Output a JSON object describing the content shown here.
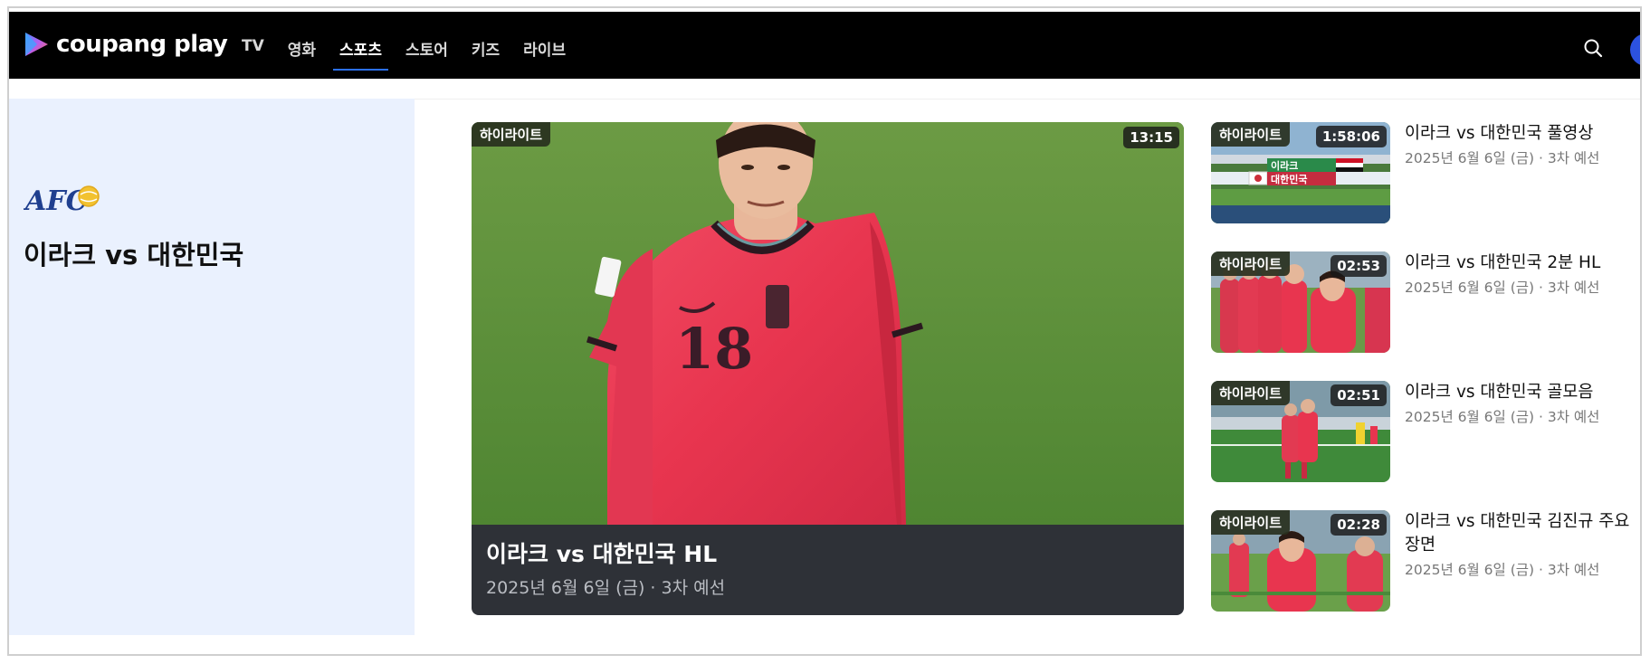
{
  "header": {
    "logo_text": "coupang play",
    "nav": [
      {
        "label": "TV",
        "active": false
      },
      {
        "label": "영화",
        "active": false
      },
      {
        "label": "스포츠",
        "active": true
      },
      {
        "label": "스토어",
        "active": false
      },
      {
        "label": "키즈",
        "active": false
      },
      {
        "label": "라이브",
        "active": false
      }
    ]
  },
  "league": {
    "logo_text": "AFC",
    "title": "이라크 vs 대한민국"
  },
  "feature": {
    "badge": "하이라이트",
    "duration": "13:15",
    "title": "이라크 vs 대한민국 HL",
    "meta": "2025년 6월 6일 (금) · 3차 예선",
    "jersey_number": "18"
  },
  "side_items": [
    {
      "badge": "하이라이트",
      "duration": "1:58:06",
      "title": "이라크 vs 대한민국 풀영상",
      "meta": "2025년 6월 6일 (금) · 3차 예선",
      "scoreboard_top": "이라크",
      "scoreboard_bottom": "대한민국"
    },
    {
      "badge": "하이라이트",
      "duration": "02:53",
      "title": "이라크 vs 대한민국 2분 HL",
      "meta": "2025년 6월 6일 (금) · 3차 예선"
    },
    {
      "badge": "하이라이트",
      "duration": "02:51",
      "title": "이라크 vs 대한민국 골모음",
      "meta": "2025년 6월 6일 (금) · 3차 예선"
    },
    {
      "badge": "하이라이트",
      "duration": "02:28",
      "title": "이라크 vs 대한민국 김진규 주요 장면",
      "meta": "2025년 6월 6일 (금) · 3차 예선"
    }
  ],
  "colors": {
    "topbar": "#000000",
    "left_panel": "#eaf1fe",
    "nav_active_underline": "#2b6ff0",
    "feature_caption_bg": "#2e3137",
    "pitch_green": "#5a8f3a",
    "jersey_red": "#e8354f"
  },
  "icons": {
    "search": "search-icon",
    "logo": "coupang-play-logo-icon",
    "avatar": "user-avatar-icon"
  }
}
